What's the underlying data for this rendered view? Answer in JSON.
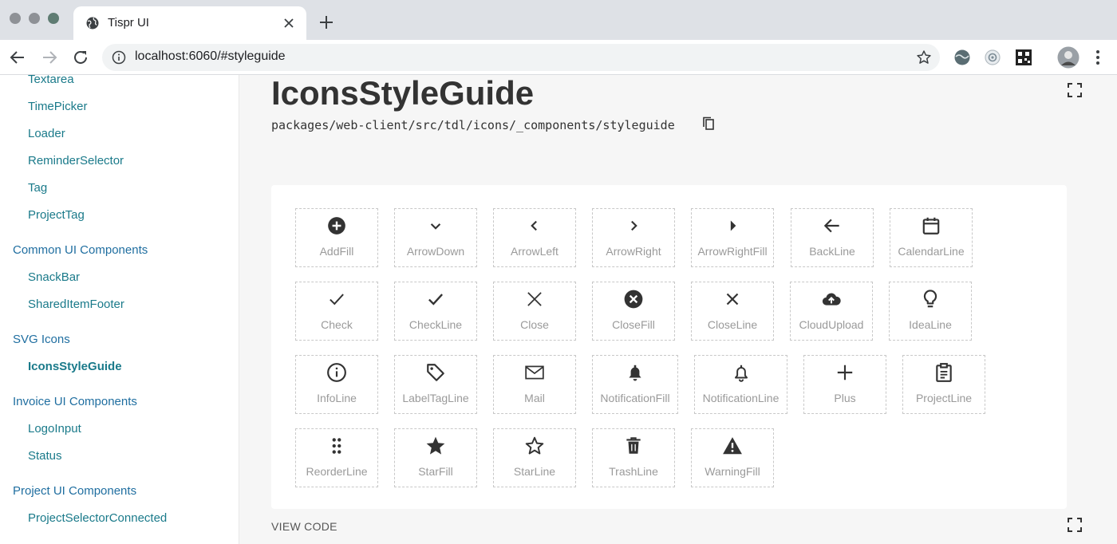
{
  "browser": {
    "tab_title": "Tispr UI",
    "url": "localhost:6060/#styleguide"
  },
  "sidebar": {
    "items": [
      {
        "label": "Textarea",
        "kind": "child"
      },
      {
        "label": "TimePicker",
        "kind": "child"
      },
      {
        "label": "Loader",
        "kind": "child"
      },
      {
        "label": "ReminderSelector",
        "kind": "child"
      },
      {
        "label": "Tag",
        "kind": "child"
      },
      {
        "label": "ProjectTag",
        "kind": "child"
      },
      {
        "label": "Common UI Components",
        "kind": "section"
      },
      {
        "label": "SnackBar",
        "kind": "child"
      },
      {
        "label": "SharedItemFooter",
        "kind": "child"
      },
      {
        "label": "SVG Icons",
        "kind": "section"
      },
      {
        "label": "IconsStyleGuide",
        "kind": "child",
        "active": true
      },
      {
        "label": "Invoice UI Components",
        "kind": "section"
      },
      {
        "label": "LogoInput",
        "kind": "child"
      },
      {
        "label": "Status",
        "kind": "child"
      },
      {
        "label": "Project UI Components",
        "kind": "section"
      },
      {
        "label": "ProjectSelectorConnected",
        "kind": "child"
      }
    ]
  },
  "main": {
    "title": "IconsStyleGuide",
    "path": "packages/web-client/src/tdl/icons/_components/styleguide",
    "view_code": "VIEW CODE"
  },
  "icons": [
    {
      "label": "AddFill",
      "icon": "add-fill-icon"
    },
    {
      "label": "ArrowDown",
      "icon": "arrow-down-icon"
    },
    {
      "label": "ArrowLeft",
      "icon": "arrow-left-icon"
    },
    {
      "label": "ArrowRight",
      "icon": "arrow-right-icon"
    },
    {
      "label": "ArrowRightFill",
      "icon": "arrow-right-fill-icon"
    },
    {
      "label": "BackLine",
      "icon": "back-line-icon"
    },
    {
      "label": "CalendarLine",
      "icon": "calendar-line-icon"
    },
    {
      "label": "Check",
      "icon": "check-icon"
    },
    {
      "label": "CheckLine",
      "icon": "check-line-icon"
    },
    {
      "label": "Close",
      "icon": "close-icon"
    },
    {
      "label": "CloseFill",
      "icon": "close-fill-icon"
    },
    {
      "label": "CloseLine",
      "icon": "close-line-icon"
    },
    {
      "label": "CloudUpload",
      "icon": "cloud-upload-icon"
    },
    {
      "label": "IdeaLine",
      "icon": "idea-line-icon"
    },
    {
      "label": "InfoLine",
      "icon": "info-line-icon"
    },
    {
      "label": "LabelTagLine",
      "icon": "label-tag-line-icon"
    },
    {
      "label": "Mail",
      "icon": "mail-icon"
    },
    {
      "label": "NotificationFill",
      "icon": "notification-fill-icon"
    },
    {
      "label": "NotificationLine",
      "icon": "notification-line-icon"
    },
    {
      "label": "Plus",
      "icon": "plus-icon"
    },
    {
      "label": "ProjectLine",
      "icon": "project-line-icon"
    },
    {
      "label": "ReorderLine",
      "icon": "reorder-line-icon"
    },
    {
      "label": "StarFill",
      "icon": "star-fill-icon"
    },
    {
      "label": "StarLine",
      "icon": "star-line-icon"
    },
    {
      "label": "TrashLine",
      "icon": "trash-line-icon"
    },
    {
      "label": "WarningFill",
      "icon": "warning-fill-icon"
    }
  ],
  "colors": {
    "link": "#1a7a8a",
    "section": "#1f6ea0",
    "icon": "#333333",
    "tile_label": "#9a9a9a"
  }
}
